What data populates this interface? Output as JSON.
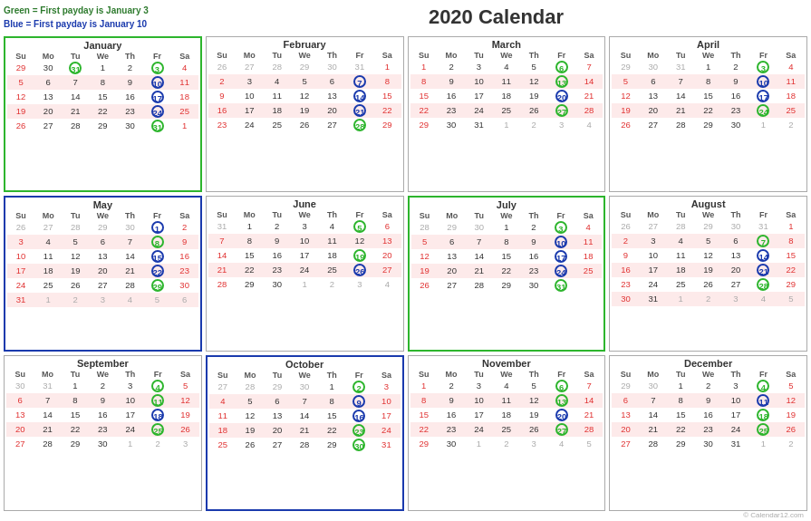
{
  "legend": {
    "green": "Green = First payday is January 3",
    "blue": "Blue = First payday is January 10"
  },
  "title": "2020 Calendar",
  "copyright": "© Calendar12.com",
  "months": [
    {
      "name": "January",
      "border": "green",
      "startDay": 3,
      "days": 31,
      "prevDays": [
        29,
        30,
        31
      ],
      "nextDays": [
        1
      ],
      "weeks": [
        [
          "29",
          "30",
          "31",
          "1",
          "2",
          "3",
          "4"
        ],
        [
          "5",
          "6",
          "7",
          "8",
          "9",
          "10",
          "11"
        ],
        [
          "12",
          "13",
          "14",
          "15",
          "16",
          "17",
          "18"
        ],
        [
          "19",
          "20",
          "21",
          "22",
          "23",
          "24",
          "25"
        ],
        [
          "26",
          "27",
          "28",
          "29",
          "30",
          "31",
          "1"
        ]
      ],
      "greenCircles": [
        "3",
        "31"
      ],
      "blueCircles": [
        "10",
        "17",
        "24"
      ]
    },
    {
      "name": "February",
      "border": "none",
      "weeks": [
        [
          "26",
          "27",
          "28",
          "29",
          "30",
          "31",
          "1"
        ],
        [
          "2",
          "3",
          "4",
          "5",
          "6",
          "7",
          "8"
        ],
        [
          "9",
          "10",
          "11",
          "12",
          "13",
          "14",
          "15"
        ],
        [
          "16",
          "17",
          "18",
          "19",
          "20",
          "21",
          "22"
        ],
        [
          "23",
          "24",
          "25",
          "26",
          "27",
          "28",
          "29"
        ]
      ],
      "otherStart": [
        "26",
        "27",
        "28",
        "29",
        "30",
        "31"
      ],
      "otherEnd": [],
      "greenCircles": [
        "28"
      ],
      "blueCircles": [
        "7",
        "14",
        "21"
      ]
    },
    {
      "name": "March",
      "border": "none",
      "weeks": [
        [
          "1",
          "2",
          "3",
          "4",
          "5",
          "6",
          "7"
        ],
        [
          "8",
          "9",
          "10",
          "11",
          "12",
          "13",
          "14"
        ],
        [
          "15",
          "16",
          "17",
          "18",
          "19",
          "20",
          "21"
        ],
        [
          "22",
          "23",
          "24",
          "25",
          "26",
          "27",
          "28"
        ],
        [
          "29",
          "30",
          "31",
          "1",
          "2",
          "3",
          "4"
        ]
      ],
      "otherEnd": [
        "1",
        "2",
        "3",
        "4"
      ],
      "greenCircles": [
        "6",
        "13",
        "27"
      ],
      "blueCircles": [
        "20"
      ]
    },
    {
      "name": "April",
      "border": "none",
      "weeks": [
        [
          "29",
          "30",
          "31",
          "1",
          "2",
          "3",
          "4"
        ],
        [
          "5",
          "6",
          "7",
          "8",
          "9",
          "10",
          "11"
        ],
        [
          "12",
          "13",
          "14",
          "15",
          "16",
          "17",
          "18"
        ],
        [
          "19",
          "20",
          "21",
          "22",
          "23",
          "24",
          "25"
        ],
        [
          "26",
          "27",
          "28",
          "29",
          "30",
          "1",
          "2"
        ]
      ],
      "otherStart": [
        "29",
        "30",
        "31"
      ],
      "otherEnd": [
        "1",
        "2"
      ],
      "greenCircles": [
        "3",
        "24"
      ],
      "blueCircles": [
        "10",
        "17"
      ]
    },
    {
      "name": "May",
      "border": "blue",
      "weeks": [
        [
          "26",
          "27",
          "28",
          "29",
          "30",
          "1",
          "2"
        ],
        [
          "3",
          "4",
          "5",
          "6",
          "7",
          "8",
          "9"
        ],
        [
          "10",
          "11",
          "12",
          "13",
          "14",
          "15",
          "16"
        ],
        [
          "17",
          "18",
          "19",
          "20",
          "21",
          "22",
          "23"
        ],
        [
          "24",
          "25",
          "26",
          "27",
          "28",
          "29",
          "30"
        ],
        [
          "31",
          "1",
          "2",
          "3",
          "4",
          "5",
          "6"
        ]
      ],
      "otherStart": [
        "26",
        "27",
        "28",
        "29",
        "30"
      ],
      "otherEnd": [
        "1",
        "2",
        "3",
        "4",
        "5",
        "6"
      ],
      "greenCircles": [
        "8",
        "29"
      ],
      "blueCircles": [
        "1",
        "15",
        "22"
      ]
    },
    {
      "name": "June",
      "border": "none",
      "weeks": [
        [
          "31",
          "1",
          "2",
          "3",
          "4",
          "5",
          "6"
        ],
        [
          "7",
          "8",
          "9",
          "10",
          "11",
          "12",
          "13"
        ],
        [
          "14",
          "15",
          "16",
          "17",
          "18",
          "19",
          "20"
        ],
        [
          "21",
          "22",
          "23",
          "24",
          "25",
          "26",
          "27"
        ],
        [
          "28",
          "29",
          "30",
          "1",
          "2",
          "3",
          "4"
        ]
      ],
      "otherStart": [
        "31"
      ],
      "otherEnd": [
        "1",
        "2",
        "3",
        "4"
      ],
      "greenCircles": [
        "5",
        "19"
      ],
      "blueCircles": [
        "26"
      ]
    },
    {
      "name": "July",
      "border": "green",
      "weeks": [
        [
          "28",
          "29",
          "30",
          "1",
          "2",
          "3",
          "4"
        ],
        [
          "5",
          "6",
          "7",
          "8",
          "9",
          "10",
          "11"
        ],
        [
          "12",
          "13",
          "14",
          "15",
          "16",
          "17",
          "18"
        ],
        [
          "19",
          "20",
          "21",
          "22",
          "23",
          "24",
          "25"
        ],
        [
          "26",
          "27",
          "28",
          "29",
          "30",
          "31",
          ""
        ]
      ],
      "otherStart": [
        "28",
        "29",
        "30"
      ],
      "greenCircles": [
        "3",
        "31"
      ],
      "blueCircles": [
        "10",
        "17",
        "24"
      ]
    },
    {
      "name": "August",
      "border": "none",
      "weeks": [
        [
          "26",
          "27",
          "28",
          "29",
          "30",
          "31",
          "1"
        ],
        [
          "2",
          "3",
          "4",
          "5",
          "6",
          "7",
          "8"
        ],
        [
          "9",
          "10",
          "11",
          "12",
          "13",
          "14",
          "15"
        ],
        [
          "16",
          "17",
          "18",
          "19",
          "20",
          "21",
          "22"
        ],
        [
          "23",
          "24",
          "25",
          "26",
          "27",
          "28",
          "29"
        ],
        [
          "30",
          "31",
          "1",
          "2",
          "3",
          "4",
          "5"
        ]
      ],
      "otherStart": [
        "26",
        "27",
        "28",
        "29",
        "30",
        "31"
      ],
      "otherEnd": [
        "1",
        "2",
        "3",
        "4",
        "5"
      ],
      "greenCircles": [
        "7",
        "28"
      ],
      "blueCircles": [
        "14",
        "21"
      ]
    },
    {
      "name": "September",
      "border": "none",
      "weeks": [
        [
          "30",
          "31",
          "1",
          "2",
          "3",
          "4",
          "5"
        ],
        [
          "6",
          "7",
          "8",
          "9",
          "10",
          "11",
          "12"
        ],
        [
          "13",
          "14",
          "15",
          "16",
          "17",
          "18",
          "19"
        ],
        [
          "20",
          "21",
          "22",
          "23",
          "24",
          "25",
          "26"
        ],
        [
          "27",
          "28",
          "29",
          "30",
          "1",
          "2",
          "3"
        ]
      ],
      "otherStart": [
        "30",
        "31"
      ],
      "otherEnd": [
        "1",
        "2",
        "3"
      ],
      "greenCircles": [
        "4",
        "11",
        "25"
      ],
      "blueCircles": [
        "18"
      ]
    },
    {
      "name": "October",
      "border": "blue",
      "weeks": [
        [
          "27",
          "28",
          "29",
          "30",
          "1",
          "2",
          "3"
        ],
        [
          "4",
          "5",
          "6",
          "7",
          "8",
          "9",
          "10"
        ],
        [
          "11",
          "12",
          "13",
          "14",
          "15",
          "16",
          "17"
        ],
        [
          "18",
          "19",
          "20",
          "21",
          "22",
          "23",
          "24"
        ],
        [
          "25",
          "26",
          "27",
          "28",
          "29",
          "30",
          "31"
        ]
      ],
      "otherStart": [
        "27",
        "28",
        "29",
        "30"
      ],
      "greenCircles": [
        "2",
        "23",
        "30"
      ],
      "blueCircles": [
        "9",
        "16"
      ]
    },
    {
      "name": "November",
      "border": "none",
      "weeks": [
        [
          "1",
          "2",
          "3",
          "4",
          "5",
          "6",
          "7"
        ],
        [
          "8",
          "9",
          "10",
          "11",
          "12",
          "13",
          "14"
        ],
        [
          "15",
          "16",
          "17",
          "18",
          "19",
          "20",
          "21"
        ],
        [
          "22",
          "23",
          "24",
          "25",
          "26",
          "27",
          "28"
        ],
        [
          "29",
          "30",
          "1",
          "2",
          "3",
          "4",
          "5"
        ]
      ],
      "otherEnd": [
        "1",
        "2",
        "3",
        "4",
        "5"
      ],
      "greenCircles": [
        "6",
        "13",
        "27"
      ],
      "blueCircles": [
        "20"
      ]
    },
    {
      "name": "December",
      "border": "none",
      "weeks": [
        [
          "29",
          "30",
          "1",
          "2",
          "3",
          "4",
          "5"
        ],
        [
          "6",
          "7",
          "8",
          "9",
          "10",
          "11",
          "12"
        ],
        [
          "13",
          "14",
          "15",
          "16",
          "17",
          "18",
          "19"
        ],
        [
          "20",
          "21",
          "22",
          "23",
          "24",
          "25",
          "26"
        ],
        [
          "27",
          "28",
          "29",
          "30",
          "31",
          "1",
          "2"
        ]
      ],
      "otherStart": [
        "29",
        "30"
      ],
      "otherEnd": [
        "1",
        "2"
      ],
      "greenCircles": [
        "4",
        "18",
        "25"
      ],
      "blueCircles": [
        "11"
      ]
    }
  ]
}
